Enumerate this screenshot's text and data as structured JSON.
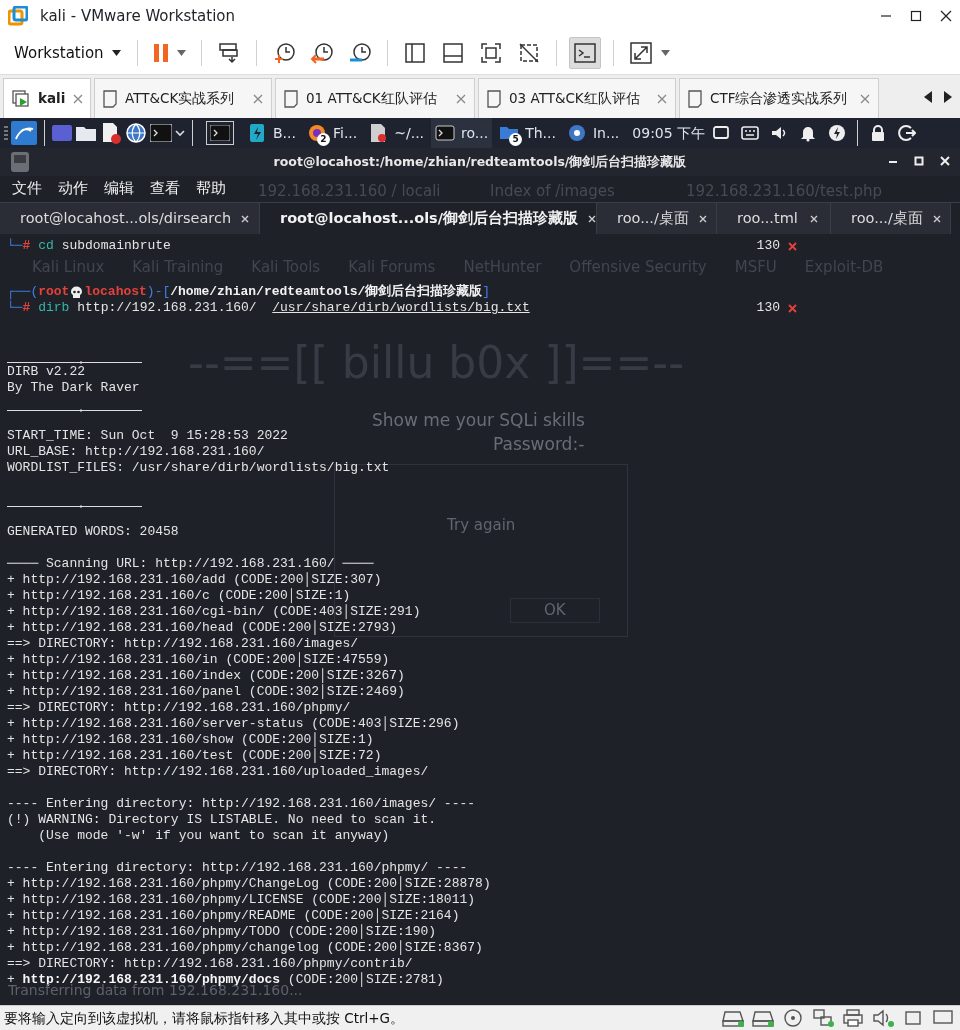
{
  "window": {
    "title": "kali - VMware Workstation"
  },
  "toolbar": {
    "menu_label": "Workstation"
  },
  "vm_tabs": [
    {
      "label": "kali",
      "selected": true
    },
    {
      "label": "ATT&CK实战系列",
      "selected": false
    },
    {
      "label": "01 ATT&CK红队评估",
      "selected": false
    },
    {
      "label": "03 ATT&CK红队评估",
      "selected": false
    },
    {
      "label": "CTF综合渗透实战系列",
      "selected": false
    }
  ],
  "taskbar": {
    "items": [
      {
        "label": "B...",
        "selected": false
      },
      {
        "label": "Fi...",
        "badge": "2",
        "selected": false
      },
      {
        "label": "~/...",
        "selected": false
      },
      {
        "label": "ro...",
        "selected": true
      },
      {
        "label": "Th...",
        "badge": "5",
        "selected": false
      },
      {
        "label": "In...",
        "selected": false
      }
    ],
    "clock": "09:05 下午"
  },
  "terminal": {
    "title": "root@locahost:/home/zhian/redteamtools/御剑后台扫描珍藏版",
    "menu": [
      "文件",
      "动作",
      "编辑",
      "查看",
      "帮助"
    ],
    "tabs": [
      {
        "label": "root@locahost...ols/dirsearch",
        "selected": false
      },
      {
        "label": "root@locahost...ols/御剑后台扫描珍藏版",
        "selected": true
      },
      {
        "label": "roo.../桌面",
        "selected": false
      },
      {
        "label": "roo...tml",
        "selected": false
      },
      {
        "label": "roo.../桌面",
        "selected": false
      }
    ],
    "lines": [
      {
        "kind": "command",
        "frame": "└─",
        "symbol": "#",
        "command": "cd",
        "args": "subdomainbrute",
        "status": "130"
      },
      {
        "kind": "blank"
      },
      {
        "kind": "gap"
      },
      {
        "kind": "prompt",
        "open": "┌──(",
        "user": "root",
        "host": "locahost",
        "mid": ")-[",
        "path": "/home/zhian/redteamtools/御剑后台扫描珍藏版",
        "close": "]"
      },
      {
        "kind": "command",
        "frame": "└─",
        "symbol": "#",
        "command": "dirb",
        "args": "http://192.168.231.160/",
        "file": "/usr/share/dirb/wordlists/big.txt",
        "status": "130"
      },
      {
        "kind": "blank"
      },
      {
        "kind": "blank"
      },
      {
        "kind": "rule"
      },
      {
        "kind": "text",
        "text": "DIRB v2.22"
      },
      {
        "kind": "text",
        "text": "By The Dark Raver"
      },
      {
        "kind": "rule"
      },
      {
        "kind": "blank"
      },
      {
        "kind": "text",
        "text": "START_TIME: Sun Oct  9 15:28:53 2022"
      },
      {
        "kind": "text",
        "text": "URL_BASE: http://192.168.231.160/"
      },
      {
        "kind": "text",
        "text": "WORDLIST_FILES: /usr/share/dirb/wordlists/big.txt"
      },
      {
        "kind": "blank"
      },
      {
        "kind": "rule"
      },
      {
        "kind": "blank"
      },
      {
        "kind": "text",
        "text": "GENERATED WORDS: 20458"
      },
      {
        "kind": "blank"
      },
      {
        "kind": "text",
        "text": "──── Scanning URL: http://192.168.231.160/ ────"
      },
      {
        "kind": "text",
        "text": "+ http://192.168.231.160/add (CODE:200│SIZE:307)"
      },
      {
        "kind": "text",
        "text": "+ http://192.168.231.160/c (CODE:200│SIZE:1)"
      },
      {
        "kind": "text",
        "text": "+ http://192.168.231.160/cgi-bin/ (CODE:403│SIZE:291)"
      },
      {
        "kind": "text",
        "text": "+ http://192.168.231.160/head (CODE:200│SIZE:2793)"
      },
      {
        "kind": "text",
        "text": "==> DIRECTORY: http://192.168.231.160/images/"
      },
      {
        "kind": "text",
        "text": "+ http://192.168.231.160/in (CODE:200│SIZE:47559)"
      },
      {
        "kind": "text",
        "text": "+ http://192.168.231.160/index (CODE:200│SIZE:3267)"
      },
      {
        "kind": "text",
        "text": "+ http://192.168.231.160/panel (CODE:302│SIZE:2469)"
      },
      {
        "kind": "text",
        "text": "==> DIRECTORY: http://192.168.231.160/phpmy/"
      },
      {
        "kind": "text",
        "text": "+ http://192.168.231.160/server-status (CODE:403│SIZE:296)"
      },
      {
        "kind": "text",
        "text": "+ http://192.168.231.160/show (CODE:200│SIZE:1)"
      },
      {
        "kind": "text",
        "text": "+ http://192.168.231.160/test (CODE:200│SIZE:72)"
      },
      {
        "kind": "text",
        "text": "==> DIRECTORY: http://192.168.231.160/uploaded_images/"
      },
      {
        "kind": "blank"
      },
      {
        "kind": "text",
        "text": "---- Entering directory: http://192.168.231.160/images/ ----"
      },
      {
        "kind": "text",
        "text": "(!) WARNING: Directory IS LISTABLE. No need to scan it."
      },
      {
        "kind": "text",
        "text": "    (Use mode '-w' if you want to scan it anyway)"
      },
      {
        "kind": "blank"
      },
      {
        "kind": "text",
        "text": "---- Entering directory: http://192.168.231.160/phpmy/ ----"
      },
      {
        "kind": "text",
        "text": "+ http://192.168.231.160/phpmy/ChangeLog (CODE:200│SIZE:28878)"
      },
      {
        "kind": "text",
        "text": "+ http://192.168.231.160/phpmy/LICENSE (CODE:200│SIZE:18011)"
      },
      {
        "kind": "text",
        "text": "+ http://192.168.231.160/phpmy/README (CODE:200│SIZE:2164)"
      },
      {
        "kind": "text",
        "text": "+ http://192.168.231.160/phpmy/TODO (CODE:200│SIZE:190)"
      },
      {
        "kind": "text",
        "text": "+ http://192.168.231.160/phpmy/changelog (CODE:200│SIZE:8367)"
      },
      {
        "kind": "text",
        "text": "==> DIRECTORY: http://192.168.231.160/phpmy/contrib/"
      },
      {
        "kind": "text",
        "text": "+ **http://192.168.231.160/phpmy/docs** (CODE:200│SIZE:2781)"
      }
    ]
  },
  "background_page": {
    "tabs": [
      "192.168.231.160 / locali",
      "Index of /images",
      "192.168.231.160/test.php"
    ],
    "bookmarks": [
      "Kali Linux",
      "Kali Training",
      "Kali Tools",
      "Kali Forums",
      "NetHunter",
      "Offensive Security",
      "MSFU",
      "Exploit-DB"
    ],
    "heading": "--==[[ billu b0x ]]==--",
    "prompt": "Show me your SQLi skills",
    "password_label": "Password:-",
    "message": "Try again",
    "button": "OK",
    "status": "Transferring data from 192.168.231.160..."
  },
  "status_bar": {
    "message": "要将输入定向到该虚拟机，请将鼠标指针移入其中或按 Ctrl+G。"
  }
}
